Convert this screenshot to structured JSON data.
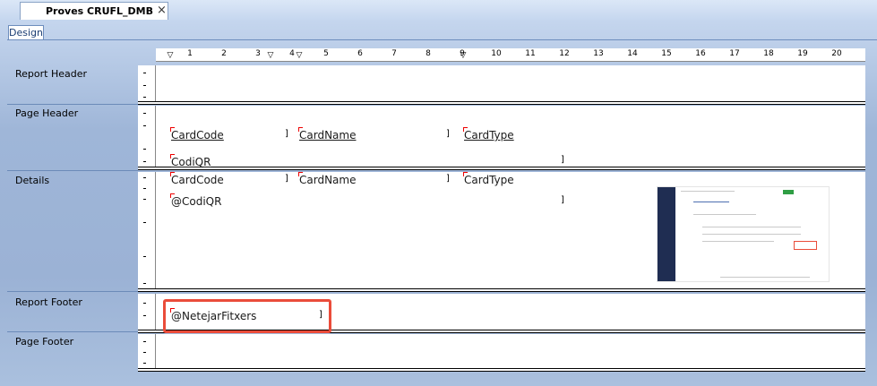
{
  "document_tab": {
    "title": "Proves CRUFL_DMB",
    "close_glyph": "×"
  },
  "view_tab": {
    "label": "Design"
  },
  "ruler": {
    "numbers": [
      "1",
      "2",
      "3",
      "4",
      "5",
      "6",
      "7",
      "8",
      "9",
      "10",
      "11",
      "12",
      "13",
      "14",
      "15",
      "16",
      "17",
      "18",
      "19",
      "20"
    ]
  },
  "sections": {
    "report_header": "Report Header",
    "page_header": "Page Header",
    "details": "Details",
    "report_footer": "Report Footer",
    "page_footer": "Page Footer"
  },
  "fields": {
    "ph_cardcode": "CardCode",
    "ph_cardname": "CardName",
    "ph_cardtype": "CardType",
    "ph_codiqr": "CodiQR",
    "d_cardcode": "CardCode",
    "d_cardname": "CardName",
    "d_cardtype": "CardType",
    "d_codiqr": "@CodiQR",
    "rf_netejar": "@NetejarFitxers"
  },
  "colors": {
    "highlight": "#ea4c3a",
    "field_marker": "#e00000",
    "band_background": "#ffffff"
  }
}
